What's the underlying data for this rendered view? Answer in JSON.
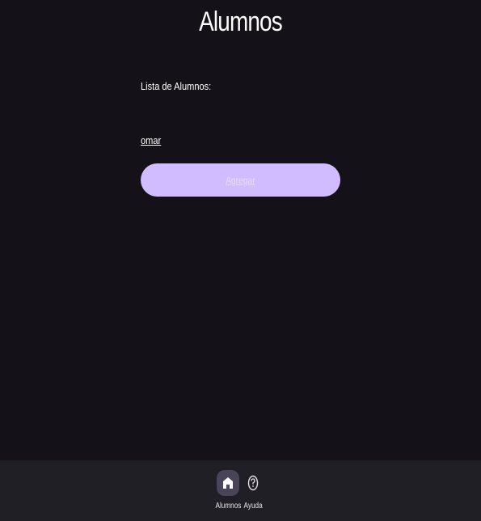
{
  "header": {
    "title": "Alumnos"
  },
  "main": {
    "list_label": "Lista de Alumnos:",
    "students": [
      "omar"
    ],
    "add_button_label": "Agregar"
  },
  "bottom_nav": {
    "items": [
      {
        "label": "Alumnos",
        "icon": "home-icon",
        "active": true
      },
      {
        "label": "Ayuda",
        "icon": "help-circle-icon",
        "active": false
      }
    ]
  },
  "colors": {
    "background": "#141218",
    "nav_background": "#211F26",
    "primary_button": "#D0BCFF",
    "active_indicator": "#4A4458",
    "text": "#FFFFFF"
  }
}
